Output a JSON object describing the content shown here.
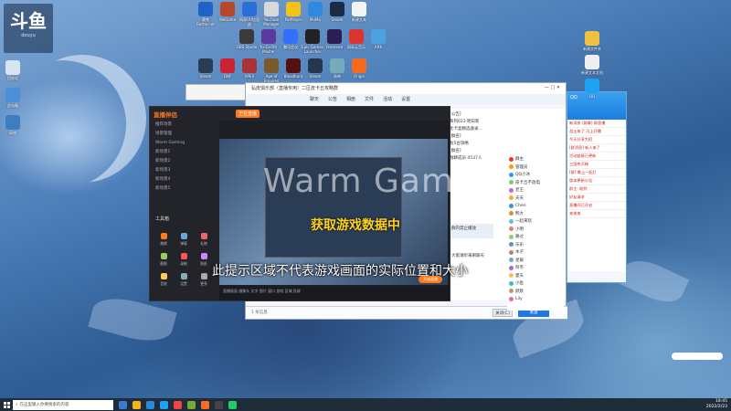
{
  "desktop": {
    "corner_logo": {
      "big": "斗鱼",
      "small": "douyu"
    },
    "icons_row1": [
      {
        "label": "魔兽 Battle.net",
        "color": "#1e64c8"
      },
      {
        "label": "WeGame",
        "color": "#b7472a"
      },
      {
        "label": "网易UU加速器",
        "color": "#2a6fd8"
      },
      {
        "label": "YouTube Manager",
        "color": "#d8d8d8"
      },
      {
        "label": "PotPlayer",
        "color": "#f6c21a"
      },
      {
        "label": "MuMu",
        "color": "#2e8ae0"
      },
      {
        "label": "Steam",
        "color": "#1a2b44"
      },
      {
        "label": "新建文本",
        "color": "#f4f4f4"
      }
    ],
    "icons_row2": [
      {
        "label": "OBS Studio",
        "color": "#3a3a3a"
      },
      {
        "label": "Yu-Gi-Oh! Master Duel",
        "color": "#5b3aa0"
      },
      {
        "label": "腾讯会议",
        "color": "#3370ff"
      },
      {
        "label": "Epic Games Launcher",
        "color": "#222"
      },
      {
        "label": "Premiere",
        "color": "#2b1e55"
      },
      {
        "label": "网易云音乐",
        "color": "#d33"
      },
      {
        "label": "ARK",
        "color": "#4aa2e0"
      }
    ],
    "icons_row3": [
      {
        "label": "Steam",
        "color": "#2b3d55"
      },
      {
        "label": "DNF",
        "color": "#c23"
      },
      {
        "label": "APEX",
        "color": "#a33"
      },
      {
        "label": "Age of Empires",
        "color": "#7a5a2a"
      },
      {
        "label": "Bloodhunt",
        "color": "#511"
      },
      {
        "label": "Steam",
        "color": "#26364f"
      },
      {
        "label": "原神",
        "color": "#7ab"
      },
      {
        "label": "Origin",
        "color": "#f56a1b"
      }
    ],
    "icons_left": [
      {
        "label": "回收站",
        "color": "#d9e4f0"
      },
      {
        "label": "此电脑",
        "color": "#4a8fd8"
      },
      {
        "label": "网络",
        "color": "#3f7cc0"
      }
    ],
    "icons_right": [
      {
        "label": "新建文件夹",
        "color": "#f0c040"
      },
      {
        "label": "新建文本文档",
        "color": "#eee"
      },
      {
        "label": "QQ",
        "color": "#1da1f2"
      }
    ]
  },
  "chat_window": {
    "title": "弘皮俱乐部（直播专用）二区皮卡丘攻略群",
    "tabs": [
      "聊天",
      "公告",
      "相册",
      "文件",
      "活动",
      "设置"
    ],
    "messages": [
      "[公告]",
      "系列023 明日新",
      "此卡盒精选收录...",
      "[群名]",
      "有5台攻略",
      "[群名]",
      "群聊成员 4537人"
    ],
    "send_label": "发送",
    "close_label": "关闭(C)",
    "input_hint": "1 条信息",
    "float_msg_1": "群内禁止播放",
    "float_msg_2": "大家请听来刷聊天"
  },
  "members": [
    {
      "name": "群主",
      "color": "#e33"
    },
    {
      "name": "管理员",
      "color": "#f90"
    },
    {
      "name": "QQ小冰",
      "color": "#39f"
    },
    {
      "name": "皮卡丘不放电",
      "color": "#7c7"
    },
    {
      "name": "老王",
      "color": "#c6c"
    },
    {
      "name": "天天",
      "color": "#fa3"
    },
    {
      "name": "Chen",
      "color": "#39c"
    },
    {
      "name": "熊大",
      "color": "#c93"
    },
    {
      "name": "一起来玩",
      "color": "#6bd"
    },
    {
      "name": "小明",
      "color": "#e77"
    },
    {
      "name": "路过",
      "color": "#9c6"
    },
    {
      "name": "乐乐",
      "color": "#68c"
    },
    {
      "name": "木子",
      "color": "#c77"
    },
    {
      "name": "星辰",
      "color": "#6ac"
    },
    {
      "name": "阿杰",
      "color": "#a6c"
    },
    {
      "name": "夏天",
      "color": "#fb5"
    },
    {
      "name": "小鱼",
      "color": "#4bb"
    },
    {
      "name": "默默",
      "color": "#b96"
    },
    {
      "name": "Lily",
      "color": "#e6a"
    }
  ],
  "qq_window": {
    "title": "QQ",
    "rows": [
      "新消息 [群聊] 群直播",
      "战士来了 马上开播",
      "今天分享大招",
      "[群消息] 新人来了",
      "活动链接已更新",
      "三国杀天梯",
      "[群] 晚上一起打",
      "版本更新公告",
      "群主: 收到",
      "好友请求",
      "直播间已开启",
      "来来来"
    ]
  },
  "stream_app": {
    "logo": "直播伴侣",
    "tab_label": "正在直播",
    "sidebar": [
      "推荐场景",
      "场景管理",
      "Warm Gaming",
      "新场景1",
      "新场景2",
      "新场景3",
      "新场景4",
      "新场景5"
    ],
    "tools_title": "工具箱",
    "tools": [
      {
        "label": "美颜",
        "color": "#ff7a1a"
      },
      {
        "label": "弹幕",
        "color": "#6ad"
      },
      {
        "label": "礼物",
        "color": "#e66"
      },
      {
        "label": "截图",
        "color": "#9c6"
      },
      {
        "label": "录制",
        "color": "#f55"
      },
      {
        "label": "贴纸",
        "color": "#c8f"
      },
      {
        "label": "音效",
        "color": "#fc5"
      },
      {
        "label": "设置",
        "color": "#8ab"
      },
      {
        "label": "更多",
        "color": "#aaa"
      }
    ],
    "bottom_bar": "直播画面   摄像头   文字   图片   窗口   游戏   区域   投屏",
    "overlay_word": "Warm Game",
    "status_text": "获取游戏数据中",
    "notice_text": "此提示区域不代表游戏画面的实际位置和大小",
    "badge": "开始直播"
  },
  "taskbar": {
    "search_placeholder": "在这里输入你要搜索的内容",
    "tray_time": "18:45",
    "tray_date": "2022/2/23",
    "app_icons": [
      "#3a7bd5",
      "#f3b31a",
      "#2b88d8",
      "#1da1f2",
      "#e44",
      "#7a3",
      "#fa6d1e",
      "#444",
      "#2c6"
    ]
  }
}
